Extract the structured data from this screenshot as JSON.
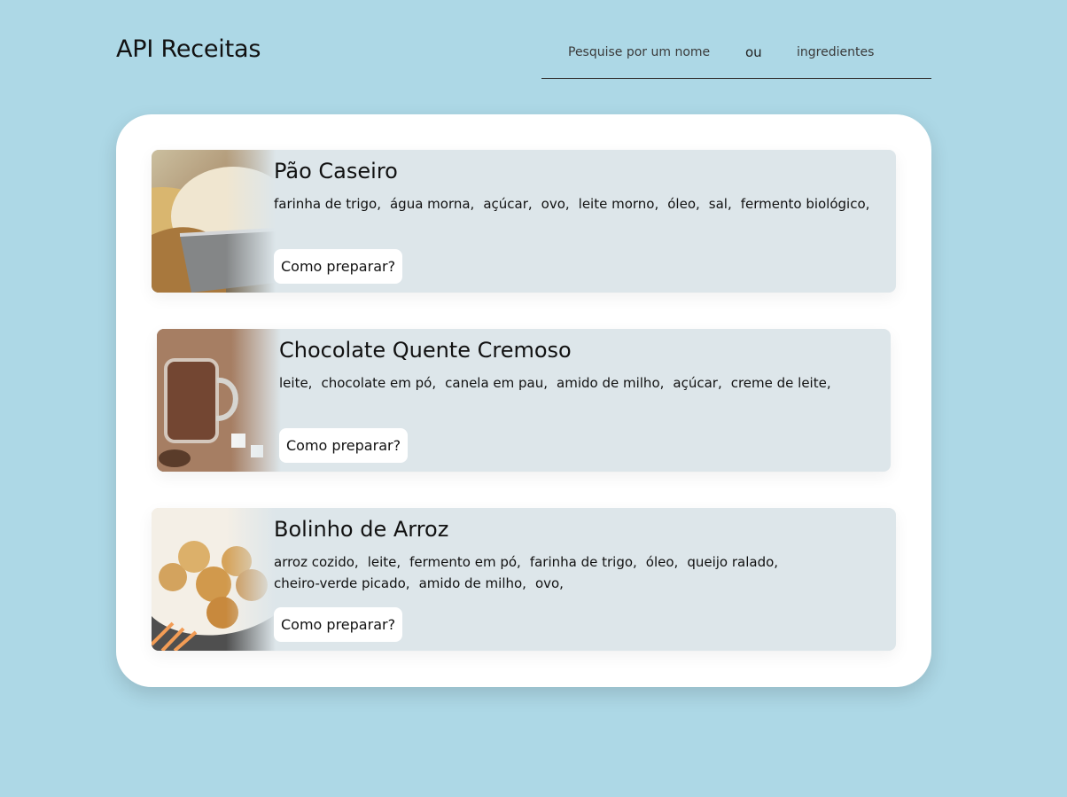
{
  "header": {
    "title": "API Receitas",
    "search": {
      "name_placeholder": "Pesquise por um nome",
      "separator": "ou",
      "ingredients_placeholder": "ingredientes"
    }
  },
  "recipes": [
    {
      "title": "Pão Caseiro",
      "ingredients": [
        "farinha de trigo,",
        "água morna,",
        "açúcar,",
        "ovo,",
        "leite morno,",
        "óleo,",
        "sal,",
        "fermento biológico,"
      ],
      "button_label": "Como preparar?"
    },
    {
      "title": "Chocolate Quente Cremoso",
      "ingredients": [
        "leite,",
        "chocolate em pó,",
        "canela em pau,",
        "amido de milho,",
        "açúcar,",
        "creme de leite,"
      ],
      "button_label": "Como preparar?"
    },
    {
      "title": "Bolinho de Arroz",
      "ingredients": [
        "arroz cozido,",
        "leite,",
        "fermento em pó,",
        "farinha de trigo,",
        "óleo,",
        "queijo ralado,",
        "cheiro-verde picado,",
        "amido de milho,",
        "ovo,"
      ],
      "button_label": "Como preparar?"
    }
  ],
  "colors": {
    "page_background": "#add8e6",
    "panel_background": "#ffffff",
    "card_background": "#dde6ea",
    "text": "#111111"
  }
}
